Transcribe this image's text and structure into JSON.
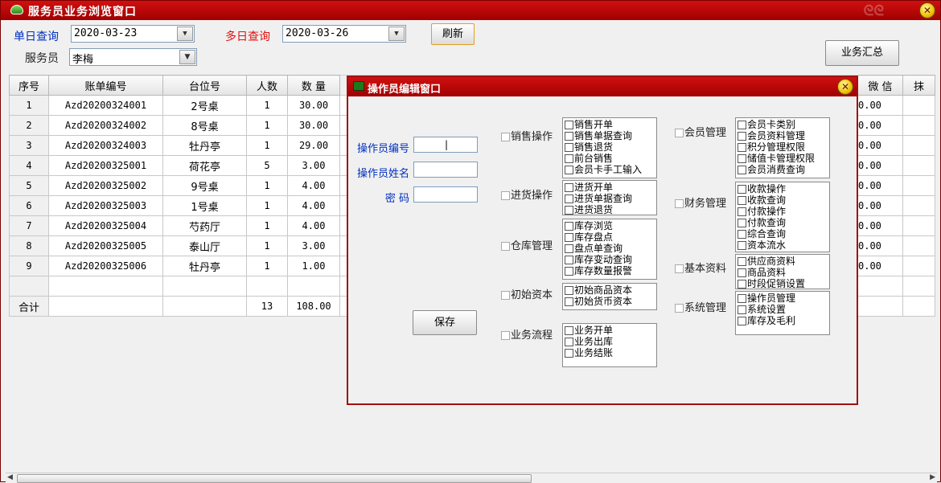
{
  "window": {
    "title": "服务员业务浏览窗口"
  },
  "filters": {
    "single_label": "单日查询",
    "single_date": "2020-03-23",
    "multi_label": "多日查询",
    "multi_date": "2020-03-26",
    "refresh_label": "刷新",
    "waiter_label": "服务员",
    "waiter_value": "李梅",
    "summary_label": "业务汇总"
  },
  "grid": {
    "headers": [
      "序号",
      "账单编号",
      "台位号",
      "人数",
      "数 量"
    ],
    "extra_headers": [
      "微 信",
      "抹"
    ],
    "rows": [
      {
        "seq": "1",
        "bill": "Azd20200324001",
        "table": "2号桌",
        "people": "1",
        "qty": "30.00",
        "wechat": "0.00"
      },
      {
        "seq": "2",
        "bill": "Azd20200324002",
        "table": "8号桌",
        "people": "1",
        "qty": "30.00",
        "wechat": "0.00"
      },
      {
        "seq": "3",
        "bill": "Azd20200324003",
        "table": "牡丹亭",
        "people": "1",
        "qty": "29.00",
        "wechat": "0.00"
      },
      {
        "seq": "4",
        "bill": "Azd20200325001",
        "table": "荷花亭",
        "people": "5",
        "qty": "3.00",
        "wechat": "0.00"
      },
      {
        "seq": "5",
        "bill": "Azd20200325002",
        "table": "9号桌",
        "people": "1",
        "qty": "4.00",
        "wechat": "0.00"
      },
      {
        "seq": "6",
        "bill": "Azd20200325003",
        "table": "1号桌",
        "people": "1",
        "qty": "4.00",
        "wechat": "0.00"
      },
      {
        "seq": "7",
        "bill": "Azd20200325004",
        "table": "芍药厅",
        "people": "1",
        "qty": "4.00",
        "wechat": "0.00"
      },
      {
        "seq": "8",
        "bill": "Azd20200325005",
        "table": "泰山厅",
        "people": "1",
        "qty": "3.00",
        "wechat": "0.00"
      },
      {
        "seq": "9",
        "bill": "Azd20200325006",
        "table": "牡丹亭",
        "people": "1",
        "qty": "1.00",
        "wechat": "0.00"
      }
    ],
    "total": {
      "label": "合计",
      "people": "13",
      "qty": "108.00"
    }
  },
  "dialog": {
    "title": "操作员编辑窗口",
    "fields": {
      "id_label": "操作员编号",
      "name_label": "操作员姓名",
      "pwd_label": "密 码"
    },
    "save_label": "保存",
    "groups": {
      "sales": {
        "label": "销售操作",
        "items": [
          "销售开单",
          "销售单据查询",
          "销售退货",
          "前台销售",
          "会员卡手工输入"
        ]
      },
      "purchase": {
        "label": "进货操作",
        "items": [
          "进货开单",
          "进货单据查询",
          "进货退货"
        ]
      },
      "warehouse": {
        "label": "仓库管理",
        "items": [
          "库存浏览",
          "库存盘点",
          "盘点单查询",
          "库存变动查询",
          "库存数量报警"
        ]
      },
      "initial": {
        "label": "初始资本",
        "items": [
          "初始商品资本",
          "初始货币资本"
        ]
      },
      "flow": {
        "label": "业务流程",
        "items": [
          "业务开单",
          "业务出库",
          "业务结账"
        ]
      },
      "member": {
        "label": "会员管理",
        "items": [
          "会员卡类别",
          "会员资料管理",
          "积分管理权限",
          "储值卡管理权限",
          "会员消费查询"
        ]
      },
      "finance": {
        "label": "财务管理",
        "items": [
          "收款操作",
          "收款查询",
          "付款操作",
          "付款查询",
          "综合查询",
          "资本流水"
        ]
      },
      "basic": {
        "label": "基本资料",
        "items": [
          "供应商资料",
          "商品资料",
          "时段促销设置"
        ]
      },
      "system": {
        "label": "系统管理",
        "items": [
          "操作员管理",
          "系统设置",
          "库存及毛利"
        ]
      }
    }
  }
}
